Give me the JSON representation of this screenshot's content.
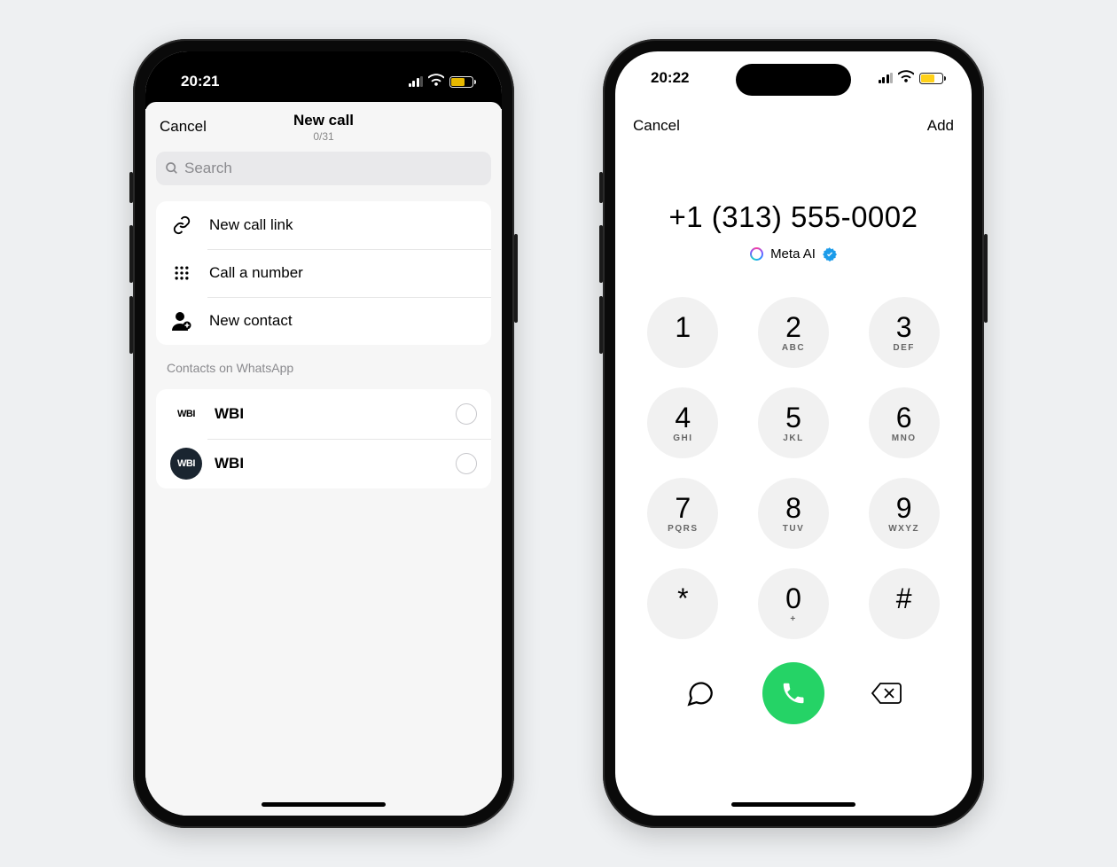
{
  "phone1": {
    "status": {
      "time": "20:21"
    },
    "header": {
      "cancel": "Cancel",
      "title": "New call",
      "subtitle": "0/31"
    },
    "search": {
      "placeholder": "Search"
    },
    "actions": [
      {
        "label": "New call link"
      },
      {
        "label": "Call a number"
      },
      {
        "label": "New contact"
      }
    ],
    "section_label": "Contacts on WhatsApp",
    "contacts": [
      {
        "avatar": "WBI",
        "name": "WBI",
        "dark": false
      },
      {
        "avatar": "WBI",
        "name": "WBI",
        "dark": true
      }
    ]
  },
  "phone2": {
    "status": {
      "time": "20:22"
    },
    "header": {
      "cancel": "Cancel",
      "add": "Add"
    },
    "number": "+1 (313) 555-0002",
    "caller_name": "Meta AI",
    "keypad": [
      {
        "d": "1",
        "l": ""
      },
      {
        "d": "2",
        "l": "ABC"
      },
      {
        "d": "3",
        "l": "DEF"
      },
      {
        "d": "4",
        "l": "GHI"
      },
      {
        "d": "5",
        "l": "JKL"
      },
      {
        "d": "6",
        "l": "MNO"
      },
      {
        "d": "7",
        "l": "PQRS"
      },
      {
        "d": "8",
        "l": "TUV"
      },
      {
        "d": "9",
        "l": "WXYZ"
      },
      {
        "d": "*",
        "l": ""
      },
      {
        "d": "0",
        "l": "+"
      },
      {
        "d": "#",
        "l": ""
      }
    ]
  }
}
